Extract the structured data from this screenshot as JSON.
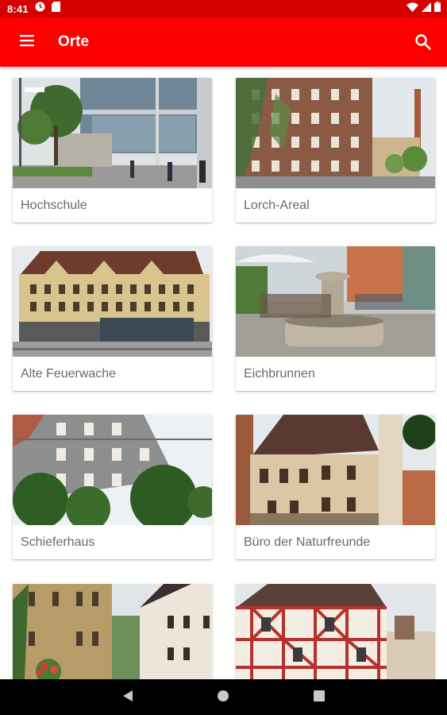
{
  "status_bar": {
    "time": "8:41",
    "left_icons": [
      "sync-icon",
      "sd-card-icon"
    ],
    "right_icons": [
      "wifi-icon",
      "signal-icon",
      "battery-icon"
    ]
  },
  "app_bar": {
    "title": "Orte",
    "menu_icon": "menu-icon",
    "search_icon": "search-icon",
    "color": "#ff0000"
  },
  "status_bar_color": "#d50000",
  "places": [
    {
      "label": "Hochschule"
    },
    {
      "label": "Lorch-Areal"
    },
    {
      "label": "Alte Feuerwache"
    },
    {
      "label": "Eichbrunnen"
    },
    {
      "label": "Schieferhaus"
    },
    {
      "label": "Büro der Naturfreunde"
    },
    {
      "label": ""
    },
    {
      "label": ""
    }
  ],
  "nav_bar": {
    "buttons": [
      "back-icon",
      "home-icon",
      "recents-icon"
    ]
  }
}
